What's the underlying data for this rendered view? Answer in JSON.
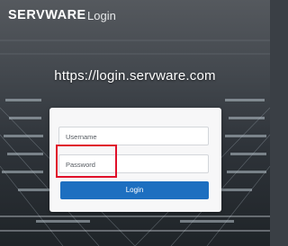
{
  "header": {
    "brand": "SERVWARE",
    "section": "Login"
  },
  "url_text": "https://login.servware.com",
  "login_form": {
    "username_placeholder": "Username",
    "password_placeholder": "Password",
    "login_label": "Login"
  },
  "colors": {
    "accent": "#1d6fc0",
    "highlight": "#e0102a"
  }
}
